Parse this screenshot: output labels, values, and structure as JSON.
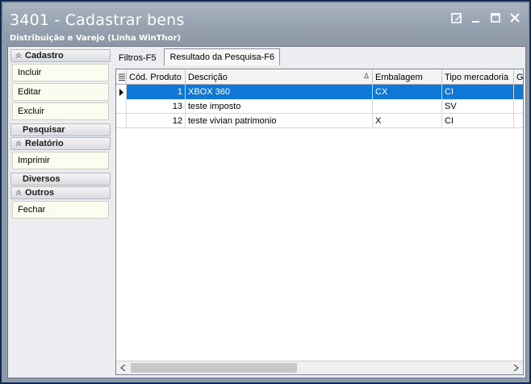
{
  "window": {
    "title": "3401 - Cadastrar bens",
    "subtitle": "Distribuição e Varejo (Linha WinThor)"
  },
  "sidebar": {
    "groups": [
      {
        "label": "Cadastro",
        "items": [
          "Incluir",
          "Editar",
          "Excluir"
        ]
      },
      {
        "label": "Pesquisar"
      },
      {
        "label": "Relatório",
        "items": [
          "Imprimir"
        ]
      },
      {
        "label": "Diversos"
      },
      {
        "label": "Outros",
        "items": [
          "Fechar"
        ]
      }
    ]
  },
  "tabs": [
    {
      "label": "Filtros-F5",
      "active": false
    },
    {
      "label": "Resultado da Pesquisa-F6",
      "active": true
    }
  ],
  "grid": {
    "columns": [
      "Cód. Produto",
      "Descrição",
      "Embalagem",
      "Tipo mercadoria",
      "G"
    ],
    "sort_indicator": "Δ",
    "rows": [
      {
        "codigo": "1",
        "descricao": "XBOX 360",
        "embalagem": "CX",
        "tipo": "CI",
        "selected": true
      },
      {
        "codigo": "13",
        "descricao": "teste imposto",
        "embalagem": "",
        "tipo": "SV",
        "selected": false
      },
      {
        "codigo": "12",
        "descricao": "teste vivian patrimonio",
        "embalagem": "X",
        "tipo": "CI",
        "selected": false
      }
    ]
  },
  "colors": {
    "selection": "#0f77d6",
    "titlebar": "#9aa5b3"
  }
}
